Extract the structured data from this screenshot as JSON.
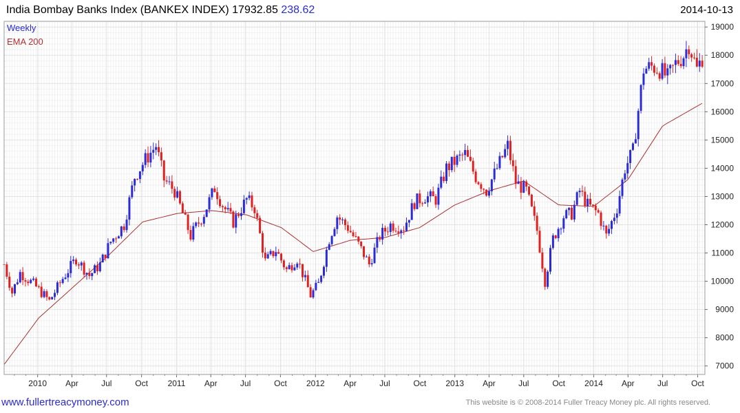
{
  "header": {
    "title": "India Bombay Banks Index (BANKEX INDEX) 17932.85",
    "change": "238.62",
    "date": "2014-10-13"
  },
  "footer": {
    "site": "www.fullertreacymoney.com",
    "copyright": "This website is © 2008-2014 Fuller Treacy Money plc. All rights reserved."
  },
  "colors": {
    "up": "#2a2ad6",
    "down": "#e02020",
    "ema": "#a83232",
    "grid": "#e2e2e2",
    "frame": "#999999"
  },
  "chart_data": {
    "type": "candlestick",
    "interval": "Weekly",
    "legend": [
      "Weekly",
      "EMA 200"
    ],
    "legend_position": "top-left",
    "grid": true,
    "y_axis_side": "right",
    "ylim": [
      6700,
      19200
    ],
    "yticks": [
      7000,
      8000,
      9000,
      10000,
      11000,
      12000,
      13000,
      14000,
      15000,
      16000,
      17000,
      18000,
      19000
    ],
    "ytick_labels": [
      "7000",
      "8000",
      "9000",
      "10000",
      "11000",
      "12000",
      "13000",
      "14000",
      "15000",
      "16000",
      "17000",
      "18000",
      "19000"
    ],
    "x_start": "2009-10-05",
    "x_end": "2014-10-20",
    "xticks": [
      {
        "label": "2010",
        "date": "2010-01-01"
      },
      {
        "label": "Apr",
        "date": "2010-04-01"
      },
      {
        "label": "Jul",
        "date": "2010-07-01"
      },
      {
        "label": "Oct",
        "date": "2010-10-01"
      },
      {
        "label": "2011",
        "date": "2011-01-01"
      },
      {
        "label": "Apr",
        "date": "2011-04-01"
      },
      {
        "label": "Jul",
        "date": "2011-07-01"
      },
      {
        "label": "Oct",
        "date": "2011-10-01"
      },
      {
        "label": "2012",
        "date": "2012-01-01"
      },
      {
        "label": "Apr",
        "date": "2012-04-01"
      },
      {
        "label": "Jul",
        "date": "2012-07-01"
      },
      {
        "label": "Oct",
        "date": "2012-10-01"
      },
      {
        "label": "2013",
        "date": "2013-01-01"
      },
      {
        "label": "Apr",
        "date": "2013-04-01"
      },
      {
        "label": "Jul",
        "date": "2013-07-01"
      },
      {
        "label": "Oct",
        "date": "2013-10-01"
      },
      {
        "label": "2014",
        "date": "2014-01-01"
      },
      {
        "label": "Apr",
        "date": "2014-04-01"
      },
      {
        "label": "Jul",
        "date": "2014-07-01"
      },
      {
        "label": "Oct",
        "date": "2014-10-01"
      }
    ],
    "close_anchors": [
      [
        "2009-10-05",
        10600
      ],
      [
        "2009-10-26",
        9600
      ],
      [
        "2009-11-16",
        10300
      ],
      [
        "2009-12-21",
        9900
      ],
      [
        "2010-02-01",
        9300
      ],
      [
        "2010-03-08",
        10100
      ],
      [
        "2010-04-12",
        10800
      ],
      [
        "2010-05-17",
        10200
      ],
      [
        "2010-06-14",
        10600
      ],
      [
        "2010-07-12",
        11400
      ],
      [
        "2010-08-16",
        12000
      ],
      [
        "2010-09-13",
        13700
      ],
      [
        "2010-10-11",
        14300
      ],
      [
        "2010-11-08",
        14800
      ],
      [
        "2010-11-29",
        13600
      ],
      [
        "2010-12-27",
        13200
      ],
      [
        "2011-02-07",
        11600
      ],
      [
        "2011-03-14",
        12400
      ],
      [
        "2011-04-11",
        13300
      ],
      [
        "2011-05-02",
        12700
      ],
      [
        "2011-05-30",
        12100
      ],
      [
        "2011-07-04",
        12900
      ],
      [
        "2011-07-25",
        12600
      ],
      [
        "2011-08-22",
        10700
      ],
      [
        "2011-09-19",
        11100
      ],
      [
        "2011-10-17",
        10400
      ],
      [
        "2011-11-14",
        10800
      ],
      [
        "2011-12-19",
        9500
      ],
      [
        "2012-01-09",
        9900
      ],
      [
        "2012-02-06",
        11500
      ],
      [
        "2012-02-27",
        12300
      ],
      [
        "2012-03-26",
        11900
      ],
      [
        "2012-04-23",
        11300
      ],
      [
        "2012-05-21",
        10600
      ],
      [
        "2012-06-18",
        11600
      ],
      [
        "2012-07-16",
        12000
      ],
      [
        "2012-08-20",
        11900
      ],
      [
        "2012-09-17",
        12800
      ],
      [
        "2012-10-15",
        13000
      ],
      [
        "2012-11-12",
        12900
      ],
      [
        "2012-12-10",
        14000
      ],
      [
        "2013-01-07",
        14300
      ],
      [
        "2013-01-28",
        14500
      ],
      [
        "2013-02-25",
        13700
      ],
      [
        "2013-03-25",
        13200
      ],
      [
        "2013-04-22",
        14000
      ],
      [
        "2013-05-20",
        14800
      ],
      [
        "2013-06-10",
        13500
      ],
      [
        "2013-07-08",
        13200
      ],
      [
        "2013-08-05",
        11800
      ],
      [
        "2013-08-26",
        10000
      ],
      [
        "2013-09-16",
        11500
      ],
      [
        "2013-10-14",
        12300
      ],
      [
        "2013-11-04",
        12400
      ],
      [
        "2013-11-25",
        13200
      ],
      [
        "2013-12-16",
        12700
      ],
      [
        "2014-01-13",
        12400
      ],
      [
        "2014-02-03",
        11600
      ],
      [
        "2014-03-03",
        12600
      ],
      [
        "2014-03-24",
        14000
      ],
      [
        "2014-04-14",
        14600
      ],
      [
        "2014-05-12",
        17500
      ],
      [
        "2014-06-02",
        17600
      ],
      [
        "2014-06-23",
        17500
      ],
      [
        "2014-07-14",
        17200
      ],
      [
        "2014-08-04",
        17700
      ],
      [
        "2014-08-25",
        18000
      ],
      [
        "2014-09-08",
        18400
      ],
      [
        "2014-09-29",
        17500
      ],
      [
        "2014-10-13",
        17933
      ]
    ],
    "ema200_anchors": [
      [
        "2009-10-05",
        7050
      ],
      [
        "2010-01-04",
        8700
      ],
      [
        "2010-04-05",
        9800
      ],
      [
        "2010-07-05",
        10900
      ],
      [
        "2010-10-04",
        12100
      ],
      [
        "2011-01-03",
        12400
      ],
      [
        "2011-04-04",
        12500
      ],
      [
        "2011-07-04",
        12350
      ],
      [
        "2011-10-03",
        11900
      ],
      [
        "2011-12-26",
        11050
      ],
      [
        "2012-04-02",
        11450
      ],
      [
        "2012-07-02",
        11550
      ],
      [
        "2012-10-01",
        11900
      ],
      [
        "2013-01-01",
        12700
      ],
      [
        "2013-04-01",
        13200
      ],
      [
        "2013-07-01",
        13550
      ],
      [
        "2013-10-01",
        12700
      ],
      [
        "2014-01-01",
        12650
      ],
      [
        "2014-04-01",
        13600
      ],
      [
        "2014-07-01",
        15500
      ],
      [
        "2014-10-13",
        16300
      ]
    ]
  }
}
